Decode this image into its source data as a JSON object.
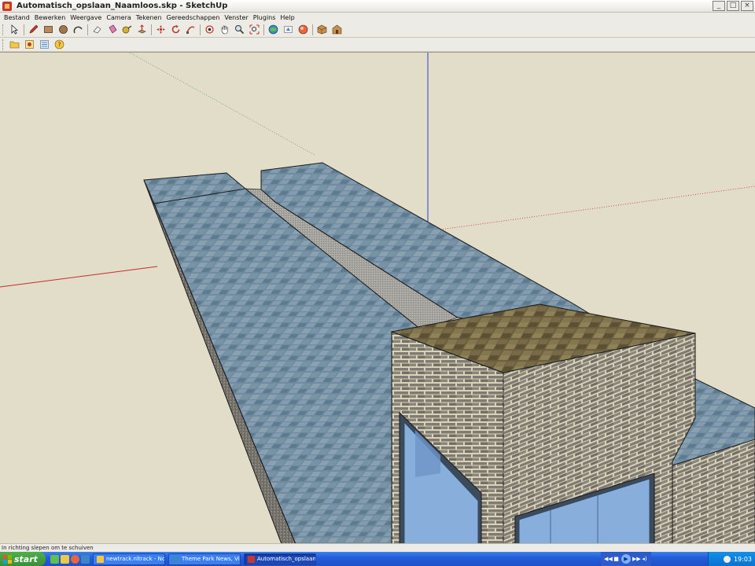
{
  "window": {
    "title": "Automatisch_opslaan_Naamloos.skp - SketchUp",
    "controls": [
      "_",
      "□",
      "×"
    ]
  },
  "menubar": {
    "items": [
      "Bestand",
      "Bewerken",
      "Weergave",
      "Camera",
      "Tekenen",
      "Gereedschappen",
      "Venster",
      "Plugins",
      "Help"
    ]
  },
  "toolbar": {
    "tools": [
      "select-icon",
      "pencil-icon",
      "rectangle-icon",
      "circle-icon",
      "arc-icon",
      "eraser-icon",
      "paint-bucket-icon",
      "tape-measure-icon",
      "push-pull-icon",
      "move-icon",
      "rotate-icon",
      "follow-me-icon",
      "orbit-icon",
      "pan-icon",
      "zoom-icon",
      "zoom-extents-icon",
      "get-models-icon",
      "share-model-icon",
      "google-earth-icon",
      "components-icon",
      "warehouse-icon"
    ],
    "secondary": [
      "open-folder-icon",
      "sketchup-ruby-icon",
      "outliner-icon",
      "help-icon"
    ]
  },
  "colors": {
    "viewport_background": "#e2ddc9",
    "roof_blue": "#6f8ba0",
    "wall_gray": "#76726c",
    "brick": "#8c8778",
    "glass": "#88aedb",
    "axis_red": "#cc2a2a",
    "axis_blue": "#2a3fd4",
    "axis_green": "#5a9a5a"
  },
  "status_bar": {
    "text": "In richting slepen om te schuiven"
  },
  "taskbar": {
    "start_label": "start",
    "tasks": [
      {
        "label": "newtrack.nltrack - No...",
        "active": false
      },
      {
        "label": "Theme Park News, Vi...",
        "active": false
      },
      {
        "label": "Automatisch_opslaan...",
        "active": true
      }
    ],
    "media": [
      "◀◀",
      "■",
      "▶",
      "▶▶",
      "◂)"
    ],
    "clock": "19:03"
  }
}
